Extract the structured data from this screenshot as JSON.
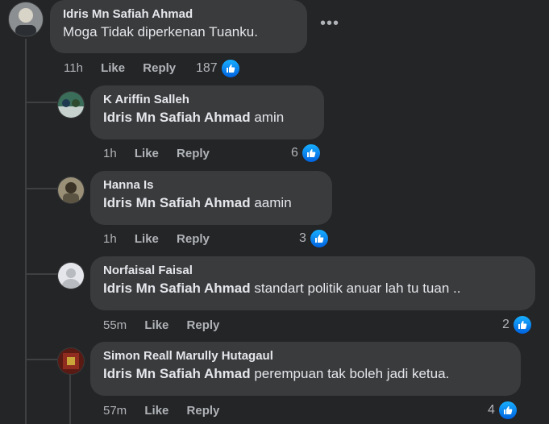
{
  "comments": [
    {
      "author": "Idris Mn Safiah Ahmad",
      "mention": "",
      "text": "Moga Tidak diperkenan Tuanku.",
      "time": "11h",
      "like": "Like",
      "reply": "Reply",
      "reactions": "187"
    },
    {
      "author": "K Ariffin Salleh",
      "mention": "Idris Mn Safiah Ahmad",
      "text": " amin",
      "time": "1h",
      "like": "Like",
      "reply": "Reply",
      "reactions": "6"
    },
    {
      "author": "Hanna Is",
      "mention": "Idris Mn Safiah Ahmad",
      "text": " aamin",
      "time": "1h",
      "like": "Like",
      "reply": "Reply",
      "reactions": "3"
    },
    {
      "author": "Norfaisal Faisal",
      "mention": "Idris Mn Safiah Ahmad",
      "text": " standart politik anuar lah tu tuan ..",
      "time": "55m",
      "like": "Like",
      "reply": "Reply",
      "reactions": "2"
    },
    {
      "author": "Simon Reall Marully Hutagaul",
      "mention": "Idris Mn Safiah Ahmad",
      "text": " perempuan tak boleh jadi ketua.",
      "time": "57m",
      "like": "Like",
      "reply": "Reply",
      "reactions": "4"
    }
  ],
  "more_icon": "more-horizontal-icon",
  "like_icon": "thumbs-up-icon"
}
